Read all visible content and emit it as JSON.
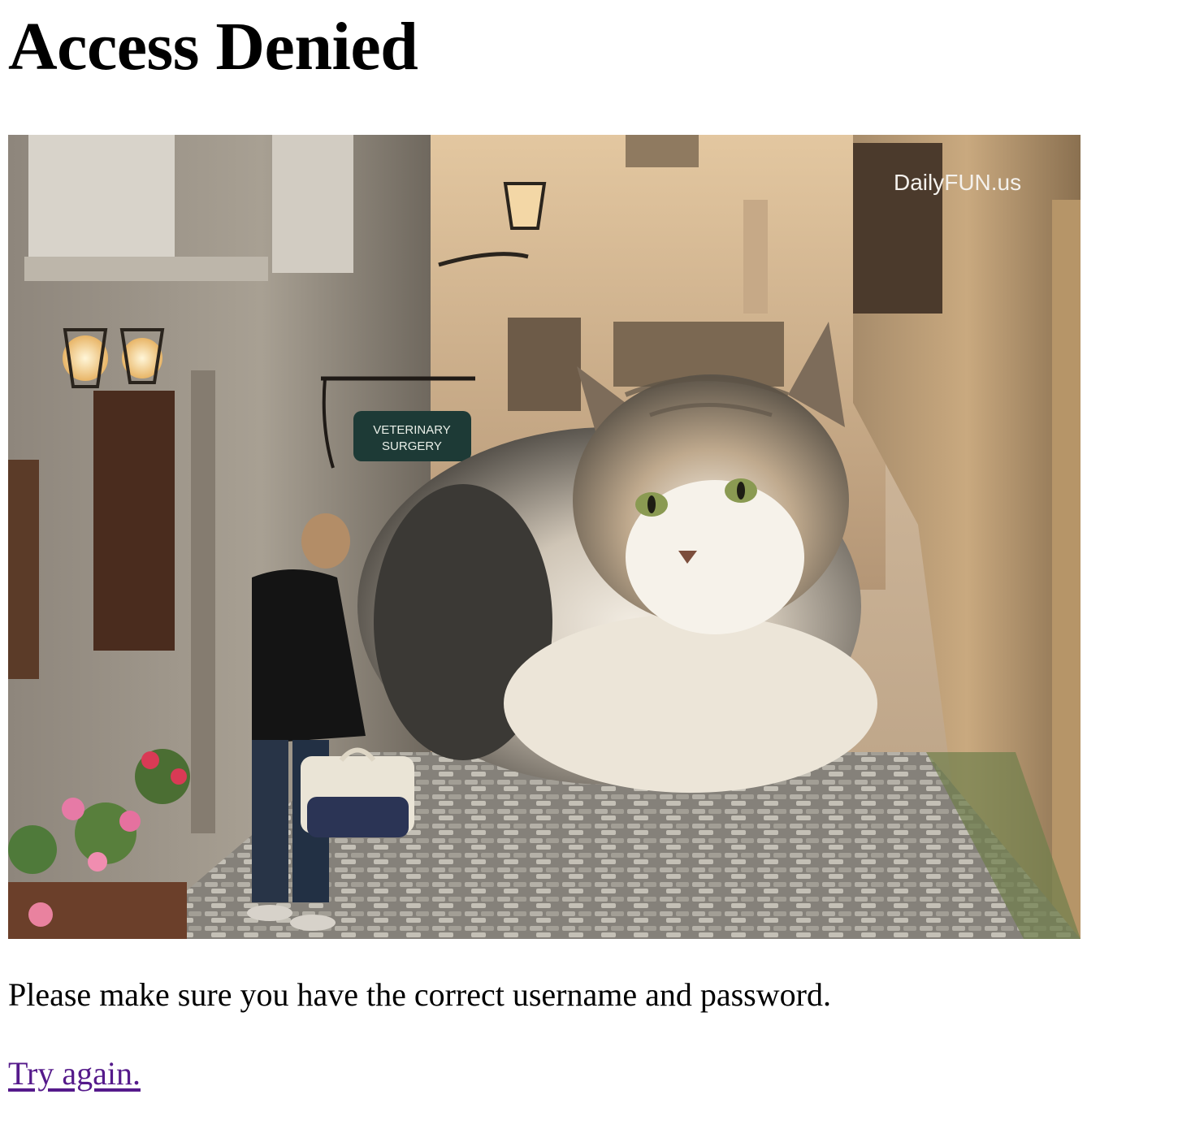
{
  "page": {
    "heading": "Access Denied",
    "message": "Please make sure you have the correct username and password.",
    "retry_link": "Try again."
  },
  "image": {
    "watermark": "DailyFUN.us",
    "sign_line1": "VETERINARY",
    "sign_line2": "SURGERY"
  },
  "colors": {
    "text": "#000000",
    "visited_link": "#551a8b",
    "background": "#ffffff"
  }
}
